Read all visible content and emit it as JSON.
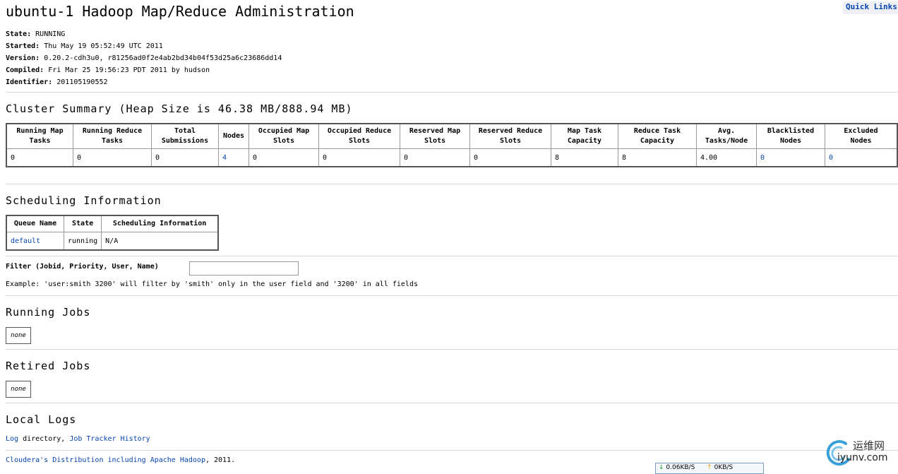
{
  "header": {
    "title": "ubuntu-1 Hadoop Map/Reduce Administration",
    "quick_links": "Quick Links"
  },
  "info": [
    {
      "label": "State:",
      "value": "RUNNING"
    },
    {
      "label": "Started:",
      "value": "Thu May 19 05:52:49 UTC 2011"
    },
    {
      "label": "Version:",
      "value": "0.20.2-cdh3u0, r81256ad0f2e4ab2bd34b04f53d25a6c23686dd14"
    },
    {
      "label": "Compiled:",
      "value": "Fri Mar 25 19:56:23 PDT 2011 by hudson"
    },
    {
      "label": "Identifier:",
      "value": "201105190552"
    }
  ],
  "cluster": {
    "heading": "Cluster Summary (Heap Size is 46.38 MB/888.94 MB)",
    "columns": [
      {
        "line1": "Running Map",
        "line2": "Tasks",
        "value": "0",
        "link": false
      },
      {
        "line1": "Running Reduce",
        "line2": "Tasks",
        "value": "0",
        "link": false
      },
      {
        "line1": "Total",
        "line2": "Submissions",
        "value": "0",
        "link": false
      },
      {
        "line1": "Nodes",
        "line2": "",
        "value": "4",
        "link": true
      },
      {
        "line1": "Occupied Map",
        "line2": "Slots",
        "value": "0",
        "link": false
      },
      {
        "line1": "Occupied Reduce",
        "line2": "Slots",
        "value": "0",
        "link": false
      },
      {
        "line1": "Reserved Map",
        "line2": "Slots",
        "value": "0",
        "link": false
      },
      {
        "line1": "Reserved Reduce",
        "line2": "Slots",
        "value": "0",
        "link": false
      },
      {
        "line1": "Map Task",
        "line2": "Capacity",
        "value": "8",
        "link": false
      },
      {
        "line1": "Reduce Task",
        "line2": "Capacity",
        "value": "8",
        "link": false
      },
      {
        "line1": "Avg.",
        "line2": "Tasks/Node",
        "value": "4.00",
        "link": false
      },
      {
        "line1": "Blacklisted",
        "line2": "Nodes",
        "value": "0",
        "link": true
      },
      {
        "line1": "Excluded",
        "line2": "Nodes",
        "value": "0",
        "link": true
      }
    ]
  },
  "scheduling": {
    "heading": "Scheduling Information",
    "headers": [
      "Queue Name",
      "State",
      "Scheduling Information"
    ],
    "row": {
      "queue": "default",
      "state": "running",
      "info": "N/A"
    }
  },
  "filter": {
    "label": "Filter (Jobid, Priority, User, Name)",
    "value": "",
    "example": "Example: 'user:smith 3200' will filter by 'smith' only in the user field and '3200' in all fields"
  },
  "running_jobs": {
    "heading": "Running Jobs",
    "none": "none"
  },
  "retired_jobs": {
    "heading": "Retired Jobs",
    "none": "none"
  },
  "local_logs": {
    "heading": "Local Logs",
    "log_link": "Log",
    "directory_text": " directory, ",
    "history_link": "Job Tracker History"
  },
  "footer": {
    "link": "Cloudera's Distribution including Apache Hadoop",
    "suffix": ", 2011."
  },
  "netbar": {
    "down": "0.06KB/S",
    "up": "0KB/S"
  },
  "watermark": {
    "cn": "运维网",
    "en": "iyunv.com"
  }
}
